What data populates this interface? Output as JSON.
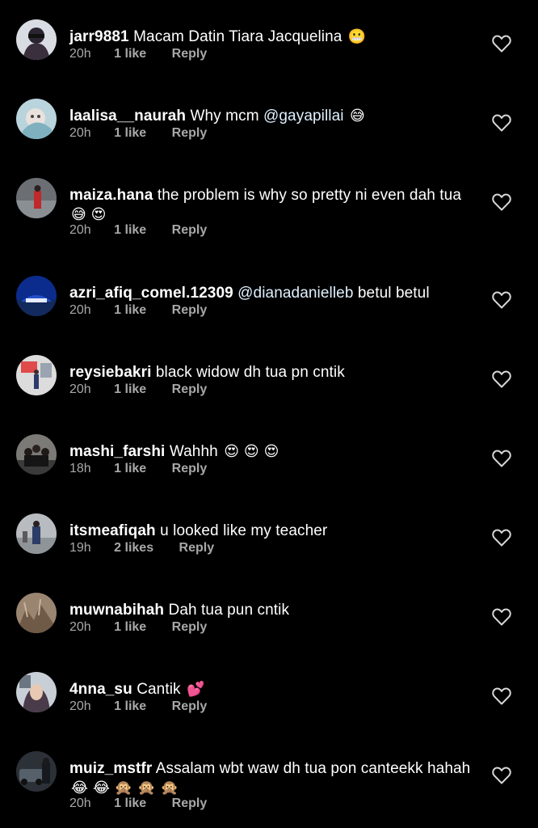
{
  "colors": {
    "background": "#000000",
    "text": "#ffffff",
    "secondary": "#a8a8a8",
    "mention": "#e0f1ff"
  },
  "icons": {
    "like": "heart-outline-icon"
  },
  "comments": [
    {
      "username": "jarr9881",
      "text": "Macam Datin Tiara Jacquelina",
      "emoji": "😬",
      "time": "20h",
      "likes": "1 like",
      "reply": "Reply"
    },
    {
      "username": "laalisa__naurah",
      "text": "Why mcm ",
      "mention": "@gayapillai",
      "emoji": "😅",
      "time": "20h",
      "likes": "1 like",
      "reply": "Reply"
    },
    {
      "username": "maiza.hana",
      "text": "the problem is why so pretty ni even dah tua",
      "emoji": "😅 😍",
      "time": "20h",
      "likes": "1 like",
      "reply": "Reply"
    },
    {
      "username": "azri_afiq_comel.12309",
      "mention": "@dianadanielleb",
      "text": " betul betul",
      "time": "20h",
      "likes": "1 like",
      "reply": "Reply"
    },
    {
      "username": "reysiebakri",
      "text": "black widow dh tua pn cntik",
      "time": "20h",
      "likes": "1 like",
      "reply": "Reply"
    },
    {
      "username": "mashi_farshi",
      "text": "Wahhh",
      "emoji": "😍 😍 😍",
      "time": "18h",
      "likes": "1 like",
      "reply": "Reply"
    },
    {
      "username": "itsmeafiqah",
      "text": "u looked like my teacher",
      "time": "19h",
      "likes": "2 likes",
      "reply": "Reply"
    },
    {
      "username": "muwnabihah",
      "text": "Dah tua pun cntik",
      "time": "20h",
      "likes": "1 like",
      "reply": "Reply"
    },
    {
      "username": "4nna_su",
      "text": "Cantik",
      "emoji": "💕",
      "time": "20h",
      "likes": "1 like",
      "reply": "Reply"
    },
    {
      "username": "muiz_mstfr",
      "text": "Assalam wbt waw dh tua pon canteekk hahah",
      "emoji": "😂 😂 🙊 🙊 🙊",
      "time": "20h",
      "likes": "1 like",
      "reply": "Reply"
    }
  ]
}
